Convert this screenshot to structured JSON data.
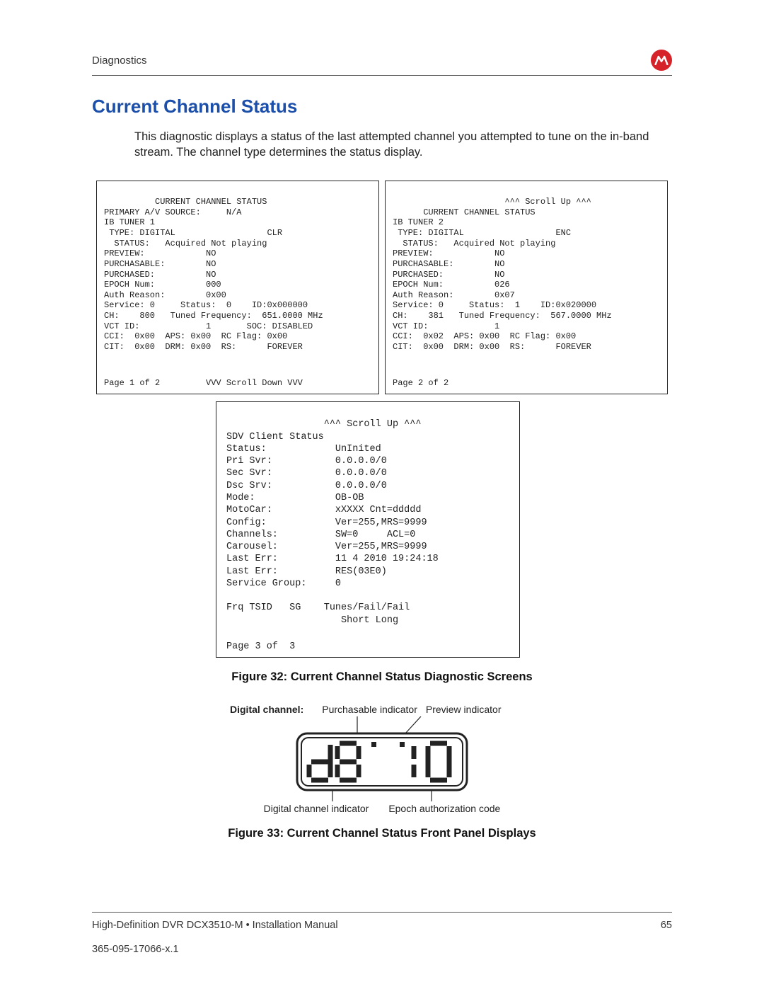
{
  "header": {
    "section": "Diagnostics"
  },
  "title": "Current Channel Status",
  "intro": "This diagnostic displays a status of the last attempted channel you attempted to tune on the in-band stream. The channel type determines the status display.",
  "screen1": {
    "line1": "          CURRENT CHANNEL STATUS",
    "line2": "PRIMARY A/V SOURCE:     N/A",
    "line3": "IB TUNER 1",
    "line4": " TYPE: DIGITAL                  CLR",
    "line5": "  STATUS:   Acquired Not playing",
    "line6": "PREVIEW:            NO",
    "line7": "PURCHASABLE:        NO",
    "line8": "PURCHASED:          NO",
    "line9": "EPOCH Num:          000",
    "line10": "Auth Reason:        0x00",
    "line11": "Service: 0     Status:  0    ID:0x000000",
    "line12": "CH:    800   Tuned Frequency:  651.0000 MHz",
    "line13": "VCT ID:             1       SOC: DISABLED",
    "line14": "CCI:  0x00  APS: 0x00  RC Flag: 0x00",
    "line15": "CIT:  0x00  DRM: 0x00  RS:      FOREVER",
    "page": "Page 1 of 2         VVV Scroll Down VVV"
  },
  "screen2": {
    "line0": "                      ^^^ Scroll Up ^^^",
    "line1": "      CURRENT CHANNEL STATUS",
    "line2": "IB TUNER 2",
    "line3": " TYPE: DIGITAL                  ENC",
    "line4": "  STATUS:   Acquired Not playing",
    "line5": "PREVIEW:            NO",
    "line6": "PURCHASABLE:        NO",
    "line7": "PURCHASED:          NO",
    "line8": "EPOCH Num:          026",
    "line9": "Auth Reason:        0x07",
    "line10": "Service: 0     Status:  1    ID:0x020000",
    "line11": "CH:    381   Tuned Frequency:  567.0000 MHz",
    "line12": "VCT ID:             1",
    "line13": "CCI:  0x02  APS: 0x00  RC Flag: 0x00",
    "line14": "CIT:  0x00  DRM: 0x00  RS:      FOREVER",
    "page": "Page 2 of 2"
  },
  "screen3": {
    "scroll": "                 ^^^ Scroll Up ^^^",
    "l1": "SDV Client Status",
    "l2": "Status:            UnInited",
    "l3": "Pri Svr:           0.0.0.0/0",
    "l4": "Sec Svr:           0.0.0.0/0",
    "l5": "Dsc Srv:           0.0.0.0/0",
    "l6": "Mode:              OB-OB",
    "l7": "MotoCar:           xXXXX Cnt=ddddd",
    "l8": "Config:            Ver=255,MRS=9999",
    "l9": "Channels:          SW=0     ACL=0",
    "l10": "Carousel:          Ver=255,MRS=9999",
    "l11": "Last Err:          11 4 2010 19:24:18",
    "l12": "Last Err:          RES(03E0)",
    "l13": "Service Group:     0",
    "blank": "",
    "l14": "Frq TSID   SG    Tunes/Fail/Fail",
    "l15": "                    Short Long",
    "page": "Page 3 of  3"
  },
  "fig32_caption": "Figure 32: Current Channel Status Diagnostic Screens",
  "fig33": {
    "digital_channel_label": "Digital channel:",
    "purchasable": "Purchasable indicator",
    "preview": "Preview indicator",
    "digital_indicator": "Digital channel indicator",
    "epoch_code": "Epoch authorization code"
  },
  "fig33_caption": "Figure 33: Current Channel Status Front Panel Displays",
  "footer": {
    "left": "High-Definition DVR DCX3510-M • Installation Manual",
    "pagenum": "65",
    "docnum": "365-095-17066-x.1"
  }
}
